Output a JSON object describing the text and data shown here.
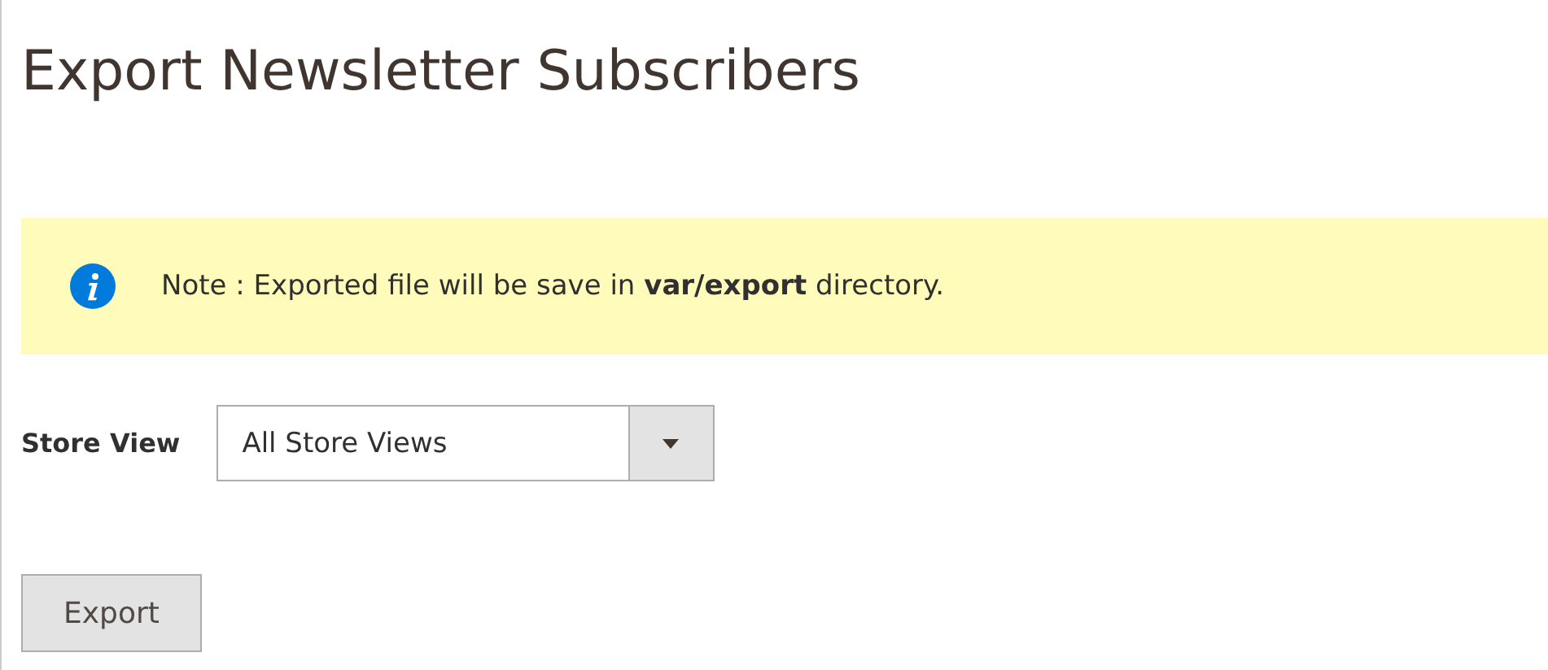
{
  "page": {
    "title": "Export Newsletter Subscribers"
  },
  "note": {
    "text": "Note : Exported file will be save in **var/export** directory."
  },
  "store_view": {
    "label": "Store View",
    "value": "All Store Views"
  },
  "buttons": [
    "Export"
  ]
}
